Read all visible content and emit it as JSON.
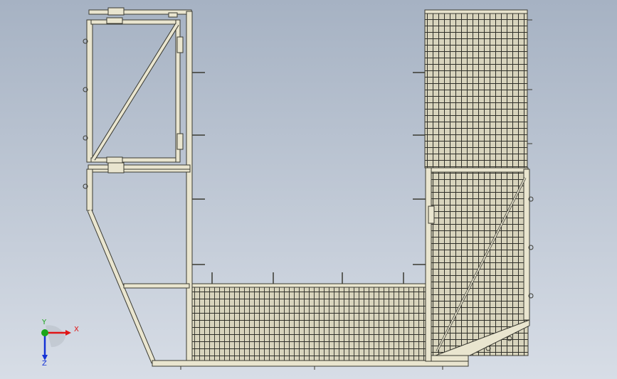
{
  "viewport": {
    "background_top": "#a6b2c3",
    "background_bottom": "#d7dde6"
  },
  "model": {
    "description_icon": "guard-fence-assembly",
    "frame_color": "#e9e5cf",
    "edge_color": "#3a3a32",
    "mesh_color": "#2e2e28"
  },
  "triad": {
    "x_label": "X",
    "y_label": "Y",
    "z_label": "Z",
    "x_color": "#e01515",
    "y_color": "#1aa51a",
    "z_color": "#1533d6"
  }
}
